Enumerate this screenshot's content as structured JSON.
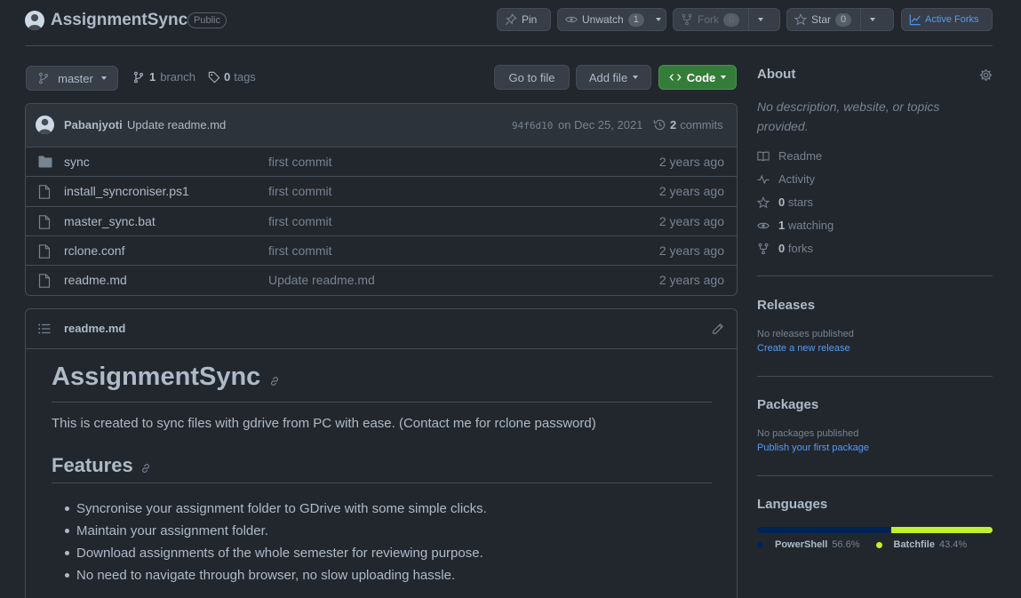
{
  "repo": {
    "name": "AssignmentSync",
    "visibility": "Public"
  },
  "actions": {
    "pin": "Pin",
    "unwatch": "Unwatch",
    "watch_count": "1",
    "fork": "Fork",
    "fork_count": "0",
    "star": "Star",
    "star_count": "0",
    "active_forks": "Active Forks"
  },
  "toolbar": {
    "branch": "master",
    "branches_count": "1",
    "branches_label": "branch",
    "tags_count": "0",
    "tags_label": "tags",
    "go_to_file": "Go to file",
    "add_file": "Add file",
    "code": "Code"
  },
  "commit": {
    "author": "Pabanjyoti",
    "message": "Update readme.md",
    "hash": "94f6d10",
    "date": "on Dec 25, 2021",
    "commits_count": "2",
    "commits_label": "commits"
  },
  "files": [
    {
      "name": "sync",
      "type": "folder",
      "message": "first commit",
      "age": "2 years ago"
    },
    {
      "name": "install_syncroniser.ps1",
      "type": "file",
      "message": "first commit",
      "age": "2 years ago"
    },
    {
      "name": "master_sync.bat",
      "type": "file",
      "message": "first commit",
      "age": "2 years ago"
    },
    {
      "name": "rclone.conf",
      "type": "file",
      "message": "first commit",
      "age": "2 years ago"
    },
    {
      "name": "readme.md",
      "type": "file",
      "message": "Update readme.md",
      "age": "2 years ago"
    }
  ],
  "readme": {
    "filename": "readme.md",
    "title": "AssignmentSync",
    "description": "This is created to sync files with gdrive from PC with ease. (Contact me for rclone password)",
    "features_heading": "Features",
    "features": [
      "Syncronise your assignment folder to GDrive with some simple clicks.",
      "Maintain your assignment folder.",
      "Download assignments of the whole semester for reviewing purpose.",
      "No need to navigate through browser, no slow uploading hassle."
    ]
  },
  "about": {
    "heading": "About",
    "description": "No description, website, or topics provided.",
    "readme": "Readme",
    "activity": "Activity",
    "stars_count": "0",
    "stars_label": "stars",
    "watching_count": "1",
    "watching_label": "watching",
    "forks_count": "0",
    "forks_label": "forks"
  },
  "releases": {
    "heading": "Releases",
    "empty": "No releases published",
    "link": "Create a new release"
  },
  "packages": {
    "heading": "Packages",
    "empty": "No packages published",
    "link": "Publish your first package"
  },
  "languages": {
    "heading": "Languages",
    "items": [
      {
        "name": "PowerShell",
        "percent": "56.6%",
        "color": "#012456",
        "share": 0.566
      },
      {
        "name": "Batchfile",
        "percent": "43.4%",
        "color": "#C1F12E",
        "share": 0.434
      }
    ]
  },
  "colors": {
    "primary_button": "#347d39",
    "link": "#539bf5",
    "background": "#22272e"
  }
}
